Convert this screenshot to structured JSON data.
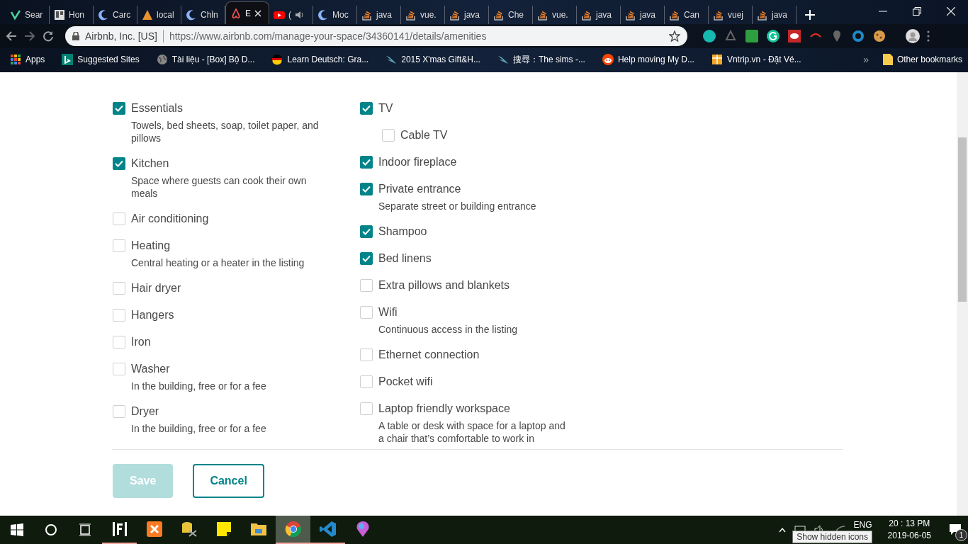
{
  "browser": {
    "tabs": [
      {
        "title": "Sear",
        "kind": "v",
        "selected": false,
        "audio": false
      },
      {
        "title": "Hon",
        "kind": "board",
        "selected": false,
        "audio": false
      },
      {
        "title": "Carc",
        "kind": "moon",
        "selected": false,
        "audio": false
      },
      {
        "title": "local",
        "kind": "triangle",
        "selected": false,
        "audio": false
      },
      {
        "title": "Chỉn",
        "kind": "moon",
        "selected": false,
        "audio": false
      },
      {
        "title": "E",
        "kind": "airbnb",
        "selected": true,
        "audio": false
      },
      {
        "title": "(",
        "kind": "play",
        "selected": false,
        "audio": true
      },
      {
        "title": "Moc",
        "kind": "moon",
        "selected": false,
        "audio": false
      },
      {
        "title": "java",
        "kind": "stack",
        "selected": false,
        "audio": false
      },
      {
        "title": "vue.",
        "kind": "stack",
        "selected": false,
        "audio": false
      },
      {
        "title": "java",
        "kind": "stack",
        "selected": false,
        "audio": false
      },
      {
        "title": "Che",
        "kind": "stack",
        "selected": false,
        "audio": false
      },
      {
        "title": "vue.",
        "kind": "stack",
        "selected": false,
        "audio": false
      },
      {
        "title": "java",
        "kind": "stack",
        "selected": false,
        "audio": false
      },
      {
        "title": "java",
        "kind": "stack",
        "selected": false,
        "audio": false
      },
      {
        "title": "Can",
        "kind": "stack",
        "selected": false,
        "audio": false
      },
      {
        "title": "vuej",
        "kind": "stack",
        "selected": false,
        "audio": false
      },
      {
        "title": "java",
        "kind": "stack",
        "selected": false,
        "audio": false
      }
    ],
    "address_bar": {
      "site": "Airbnb, Inc. [US]",
      "url": "https://www.airbnb.com/manage-your-space/34360141/details/amenities"
    },
    "bookmarks": [
      {
        "title": "Apps",
        "kind": "grid"
      },
      {
        "title": "Suggested Sites",
        "kind": "b"
      },
      {
        "title": "Tài liệu - [Box] Bộ D...",
        "kind": "globe"
      },
      {
        "title": "Learn Deutsch: Gra...",
        "kind": "flag"
      },
      {
        "title": "2015 X'mas Gift&H...",
        "kind": "wing"
      },
      {
        "title": "搜尋：The sims -...",
        "kind": "wing"
      },
      {
        "title": "Help moving My D...",
        "kind": "alien"
      },
      {
        "title": "Vntrip.vn - Đặt Vé...",
        "kind": "gift"
      }
    ],
    "bookmarks_overflow": "»",
    "other_bookmarks": "Other bookmarks"
  },
  "amenities": {
    "columns": [
      [
        {
          "label": "Essentials",
          "checked": true,
          "description": "Towels, bed sheets, soap, toilet paper, and pillows"
        },
        {
          "label": "Kitchen",
          "checked": true,
          "description": "Space where guests can cook their own meals"
        },
        {
          "label": "Air conditioning",
          "checked": false
        },
        {
          "label": "Heating",
          "checked": false,
          "description": "Central heating or a heater in the listing"
        },
        {
          "label": "Hair dryer",
          "checked": false
        },
        {
          "label": "Hangers",
          "checked": false
        },
        {
          "label": "Iron",
          "checked": false
        },
        {
          "label": "Washer",
          "checked": false,
          "description": "In the building, free or for a fee"
        },
        {
          "label": "Dryer",
          "checked": false,
          "description": "In the building, free or for a fee"
        }
      ],
      [
        {
          "label": "TV",
          "checked": true,
          "children": [
            {
              "label": "Cable TV",
              "checked": false
            }
          ]
        },
        {
          "label": "Indoor fireplace",
          "checked": true
        },
        {
          "label": "Private entrance",
          "checked": true,
          "description": "Separate street or building entrance"
        },
        {
          "label": "Shampoo",
          "checked": true
        },
        {
          "label": "Bed linens",
          "checked": true
        },
        {
          "label": "Extra pillows and blankets",
          "checked": false
        },
        {
          "label": "Wifi",
          "checked": false,
          "description": "Continuous access in the listing"
        },
        {
          "label": "Ethernet connection",
          "checked": false
        },
        {
          "label": "Pocket wifi",
          "checked": false
        },
        {
          "label": "Laptop friendly workspace",
          "checked": false,
          "description": "A table or desk with space for a laptop and a chair that’s comfortable to work in"
        }
      ]
    ]
  },
  "actions": [
    {
      "label": "Save",
      "kind": "primary",
      "disabled": true
    },
    {
      "label": "Cancel",
      "kind": "secondary",
      "disabled": false
    }
  ],
  "taskbar": {
    "apps": [
      {
        "kind": "f",
        "running": true,
        "selected": false
      },
      {
        "kind": "xampp",
        "running": false,
        "selected": false
      },
      {
        "kind": "db",
        "running": false,
        "selected": false
      },
      {
        "kind": "note",
        "running": false,
        "selected": false
      },
      {
        "kind": "folder",
        "running": false,
        "selected": false
      },
      {
        "kind": "chrome",
        "running": true,
        "selected": true
      },
      {
        "kind": "code",
        "running": true,
        "selected": false
      },
      {
        "kind": "paint",
        "running": false,
        "selected": false
      }
    ],
    "language": "ENG",
    "time": "20 : 13 PM",
    "date": "2019-06-05",
    "notifications": "1",
    "tooltip": "Show hidden icons"
  }
}
